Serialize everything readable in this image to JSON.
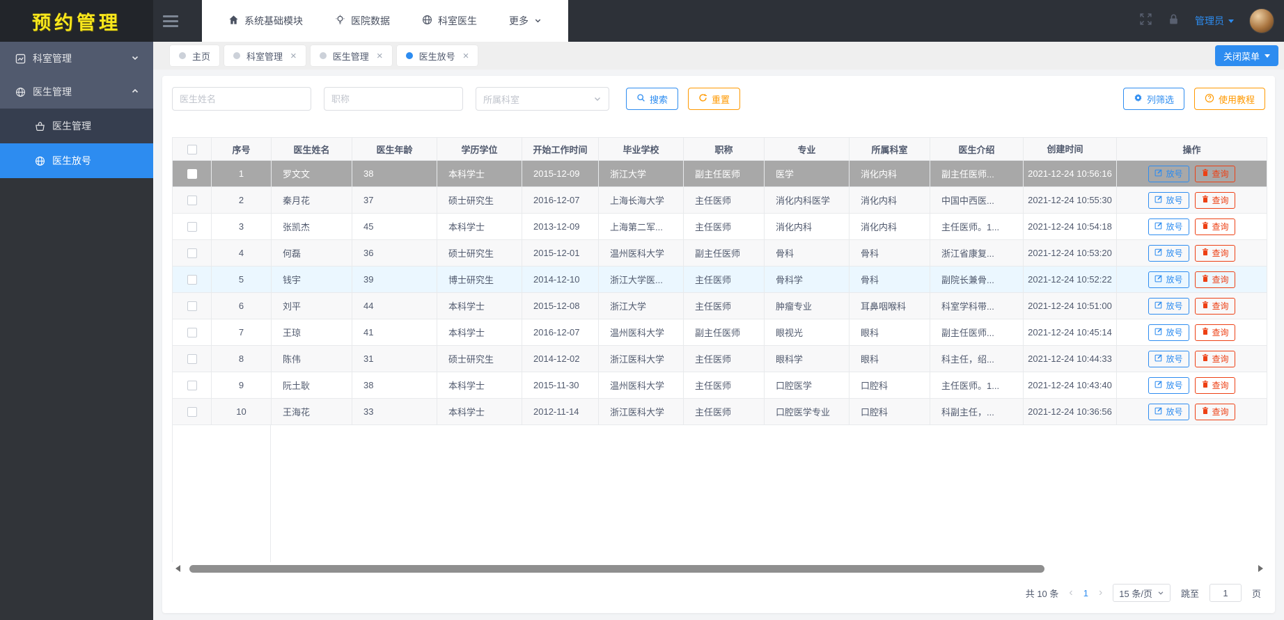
{
  "app": {
    "logo": "预约管理"
  },
  "colors": {
    "accent": "#2d8cf0",
    "warning": "#ff9900",
    "danger": "#ed4014",
    "selected_row": "#a8a8a8",
    "hover_row": "#ebf7ff",
    "logo_text": "#f8e71c"
  },
  "topnav": {
    "items": [
      {
        "label": "系统基础模块",
        "icon": "home-icon"
      },
      {
        "label": "医院数据",
        "icon": "bulb-icon"
      },
      {
        "label": "科室医生",
        "icon": "globe-icon"
      },
      {
        "label": "更多",
        "icon": "chevron-down-icon"
      }
    ],
    "user": "管理员"
  },
  "sidebar": {
    "items": [
      {
        "label": "科室管理",
        "icon": "chart-icon",
        "state": "collapsed"
      },
      {
        "label": "医生管理",
        "icon": "globe-icon",
        "state": "expanded",
        "children": [
          {
            "label": "医生管理",
            "icon": "basket-icon",
            "active": false
          },
          {
            "label": "医生放号",
            "icon": "globe-icon",
            "active": true
          }
        ]
      }
    ]
  },
  "tabbar": {
    "tabs": [
      {
        "label": "主页",
        "closable": false,
        "active": false
      },
      {
        "label": "科室管理",
        "closable": true,
        "active": false
      },
      {
        "label": "医生管理",
        "closable": true,
        "active": false
      },
      {
        "label": "医生放号",
        "closable": true,
        "active": true
      }
    ],
    "close_menu_label": "关闭菜单"
  },
  "search": {
    "name_placeholder": "医生姓名",
    "title_placeholder": "职称",
    "dept_placeholder": "所属科室",
    "search_label": "搜索",
    "reset_label": "重置",
    "filter_label": "列筛选",
    "tutorial_label": "使用教程"
  },
  "table": {
    "columns": [
      "序号",
      "医生姓名",
      "医生年龄",
      "学历学位",
      "开始工作时间",
      "毕业学校",
      "职称",
      "专业",
      "所属科室",
      "医生介绍",
      "创建时间",
      "操作"
    ],
    "actions": {
      "release": "放号",
      "query": "查询"
    },
    "rows": [
      {
        "no": "1",
        "name": "罗文文",
        "age": "38",
        "degree": "本科学士",
        "start": "2015-12-09",
        "school": "浙江大学",
        "title": "副主任医师",
        "major": "医学",
        "dept": "消化内科",
        "intro": "副主任医师...",
        "created": "2021-12-24 10:56:16",
        "state": "selected",
        "checked": true
      },
      {
        "no": "2",
        "name": "秦月花",
        "age": "37",
        "degree": "硕士研究生",
        "start": "2016-12-07",
        "school": "上海长海大学",
        "title": "主任医师",
        "major": "消化内科医学",
        "dept": "消化内科",
        "intro": "中国中西医...",
        "created": "2021-12-24 10:55:30",
        "state": "",
        "checked": false
      },
      {
        "no": "3",
        "name": "张凯杰",
        "age": "45",
        "degree": "本科学士",
        "start": "2013-12-09",
        "school": "上海第二军...",
        "title": "主任医师",
        "major": "消化内科",
        "dept": "消化内科",
        "intro": "主任医师。1...",
        "created": "2021-12-24 10:54:18",
        "state": "",
        "checked": false
      },
      {
        "no": "4",
        "name": "何磊",
        "age": "36",
        "degree": "硕士研究生",
        "start": "2015-12-01",
        "school": "温州医科大学",
        "title": "副主任医师",
        "major": "骨科",
        "dept": "骨科",
        "intro": "浙江省康复...",
        "created": "2021-12-24 10:53:20",
        "state": "",
        "checked": false
      },
      {
        "no": "5",
        "name": "钱宇",
        "age": "39",
        "degree": "博士研究生",
        "start": "2014-12-10",
        "school": "浙江大学医...",
        "title": "主任医师",
        "major": "骨科学",
        "dept": "骨科",
        "intro": "副院长兼骨...",
        "created": "2021-12-24 10:52:22",
        "state": "hover",
        "checked": false
      },
      {
        "no": "6",
        "name": "刘平",
        "age": "44",
        "degree": "本科学士",
        "start": "2015-12-08",
        "school": "浙江大学",
        "title": "主任医师",
        "major": "肿瘤专业",
        "dept": "耳鼻咽喉科",
        "intro": "科室学科带...",
        "created": "2021-12-24 10:51:00",
        "state": "",
        "checked": false
      },
      {
        "no": "7",
        "name": "王琼",
        "age": "41",
        "degree": "本科学士",
        "start": "2016-12-07",
        "school": "温州医科大学",
        "title": "副主任医师",
        "major": "眼视光",
        "dept": "眼科",
        "intro": "副主任医师...",
        "created": "2021-12-24 10:45:14",
        "state": "",
        "checked": false
      },
      {
        "no": "8",
        "name": "陈伟",
        "age": "31",
        "degree": "硕士研究生",
        "start": "2014-12-02",
        "school": "浙江医科大学",
        "title": "主任医师",
        "major": "眼科学",
        "dept": "眼科",
        "intro": "科主任，绍...",
        "created": "2021-12-24 10:44:33",
        "state": "",
        "checked": false
      },
      {
        "no": "9",
        "name": "阮土耿",
        "age": "38",
        "degree": "本科学士",
        "start": "2015-11-30",
        "school": "温州医科大学",
        "title": "主任医师",
        "major": "口腔医学",
        "dept": "口腔科",
        "intro": "主任医师。1...",
        "created": "2021-12-24 10:43:40",
        "state": "",
        "checked": false
      },
      {
        "no": "10",
        "name": "王海花",
        "age": "33",
        "degree": "本科学士",
        "start": "2012-11-14",
        "school": "浙江医科大学",
        "title": "主任医师",
        "major": "口腔医学专业",
        "dept": "口腔科",
        "intro": "科副主任，...",
        "created": "2021-12-24 10:36:56",
        "state": "",
        "checked": false
      }
    ]
  },
  "pagination": {
    "total": "共 10 条",
    "page": "1",
    "page_size": "15 条/页",
    "jump_label": "跳至",
    "jump_value": "1",
    "page_label": "页"
  }
}
